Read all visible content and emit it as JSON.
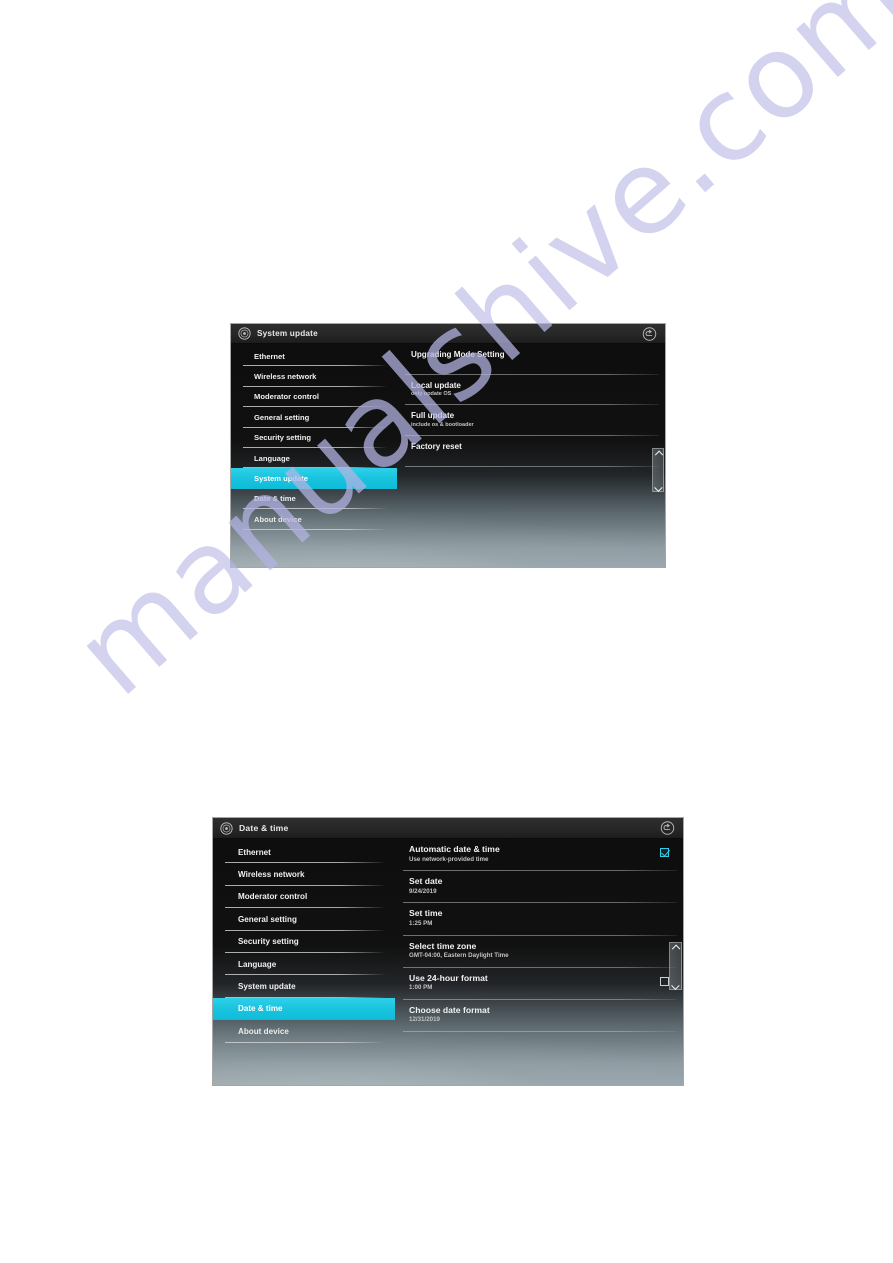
{
  "page": {
    "watermark": "manualshive.com"
  },
  "shots": [
    {
      "id": "system-update",
      "titlebar": {
        "title": "System update",
        "app_icon": "settings-gear-icon",
        "back_icon": "back-arrow-icon"
      },
      "sidebar": {
        "items": [
          {
            "label": "Ethernet",
            "selected": false
          },
          {
            "label": "Wireless network",
            "selected": false
          },
          {
            "label": "Moderator control",
            "selected": false
          },
          {
            "label": "General setting",
            "selected": false
          },
          {
            "label": "Security setting",
            "selected": false
          },
          {
            "label": "Language",
            "selected": false
          },
          {
            "label": "System update",
            "selected": true
          },
          {
            "label": "Date & time",
            "selected": false
          },
          {
            "label": "About device",
            "selected": false
          }
        ]
      },
      "prefs": [
        {
          "title": "Upgrading Mode Setting",
          "sub": "",
          "widget": "none"
        },
        {
          "title": "Local update",
          "sub": "only update OS",
          "widget": "none"
        },
        {
          "title": "Full update",
          "sub": "include os & bootloader",
          "widget": "none"
        },
        {
          "title": "Factory reset",
          "sub": "",
          "widget": "none"
        }
      ],
      "scroll_indicator": {
        "up": "chevron-up-icon",
        "down": "chevron-down-icon"
      },
      "accent_color": "#18c3de"
    },
    {
      "id": "date-time",
      "titlebar": {
        "title": "Date & time",
        "app_icon": "settings-gear-icon",
        "back_icon": "back-arrow-icon"
      },
      "sidebar": {
        "items": [
          {
            "label": "Ethernet",
            "selected": false
          },
          {
            "label": "Wireless network",
            "selected": false
          },
          {
            "label": "Moderator control",
            "selected": false
          },
          {
            "label": "General setting",
            "selected": false
          },
          {
            "label": "Security setting",
            "selected": false
          },
          {
            "label": "Language",
            "selected": false
          },
          {
            "label": "System update",
            "selected": false
          },
          {
            "label": "Date & time",
            "selected": true
          },
          {
            "label": "About device",
            "selected": false
          }
        ]
      },
      "prefs": [
        {
          "title": "Automatic date & time",
          "sub": "Use network-provided time",
          "widget": "checkbox",
          "checked": true
        },
        {
          "title": "Set date",
          "sub": "9/24/2019",
          "widget": "none"
        },
        {
          "title": "Set time",
          "sub": "1:25 PM",
          "widget": "none"
        },
        {
          "title": "Select time zone",
          "sub": "GMT-04:00, Eastern Daylight Time",
          "widget": "none"
        },
        {
          "title": "Use 24-hour format",
          "sub": "1:00 PM",
          "widget": "checkbox",
          "checked": false
        },
        {
          "title": "Choose date format",
          "sub": "12/31/2019",
          "widget": "none"
        }
      ],
      "scroll_indicator": {
        "up": "chevron-up-icon",
        "down": "chevron-down-icon"
      },
      "accent_color": "#18c3de"
    }
  ]
}
